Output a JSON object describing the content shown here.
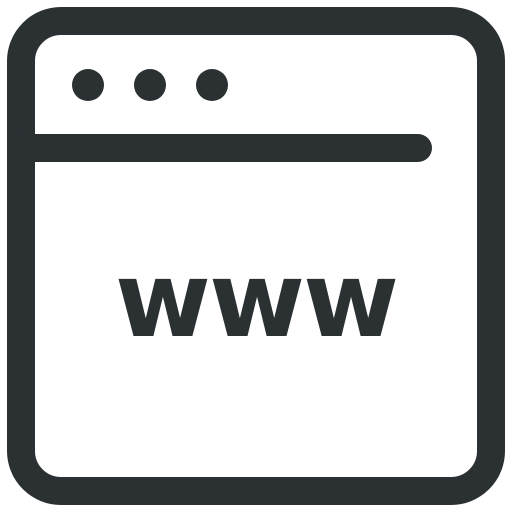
{
  "icon": {
    "name": "browser-window-icon",
    "stroke_color": "#2b3033",
    "background_color": "#ffffff",
    "label": "www"
  }
}
